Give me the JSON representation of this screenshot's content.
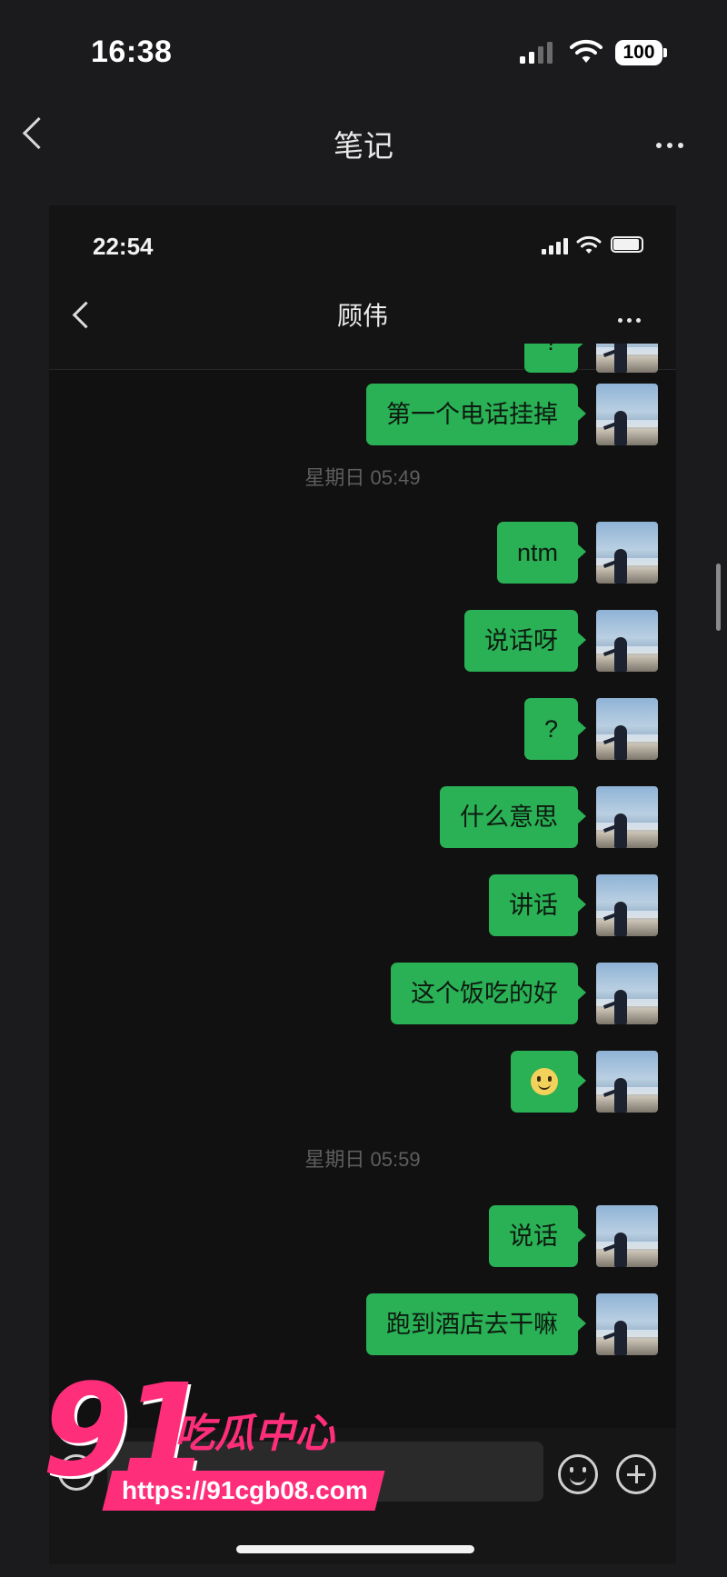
{
  "status_bar": {
    "time": "16:38",
    "battery": "100"
  },
  "nav": {
    "title": "笔记"
  },
  "screenshot": {
    "status_bar": {
      "time": "22:54"
    },
    "nav": {
      "title": "顾伟"
    },
    "messages": [
      {
        "kind": "bubble",
        "text": "?"
      },
      {
        "kind": "bubble",
        "text": "第一个电话挂掉"
      },
      {
        "kind": "time",
        "text": "星期日 05:49"
      },
      {
        "kind": "bubble",
        "text": "ntm"
      },
      {
        "kind": "bubble",
        "text": "说话呀"
      },
      {
        "kind": "bubble",
        "text": "?"
      },
      {
        "kind": "bubble",
        "text": "什么意思"
      },
      {
        "kind": "bubble",
        "text": "讲话"
      },
      {
        "kind": "bubble",
        "text": "这个饭吃的好"
      },
      {
        "kind": "emoji",
        "text": "",
        "icon": "smiley-emoji"
      },
      {
        "kind": "time",
        "text": "星期日 05:59"
      },
      {
        "kind": "bubble",
        "text": "说话"
      },
      {
        "kind": "bubble",
        "text": "跑到酒店去干嘛"
      }
    ]
  },
  "watermark": {
    "number": "91",
    "text": "吃瓜中心",
    "url": "https://91cgb08.com"
  },
  "colors": {
    "bubble": "#2ab055",
    "background": "#111111",
    "watermark": "#ff2e7a"
  }
}
